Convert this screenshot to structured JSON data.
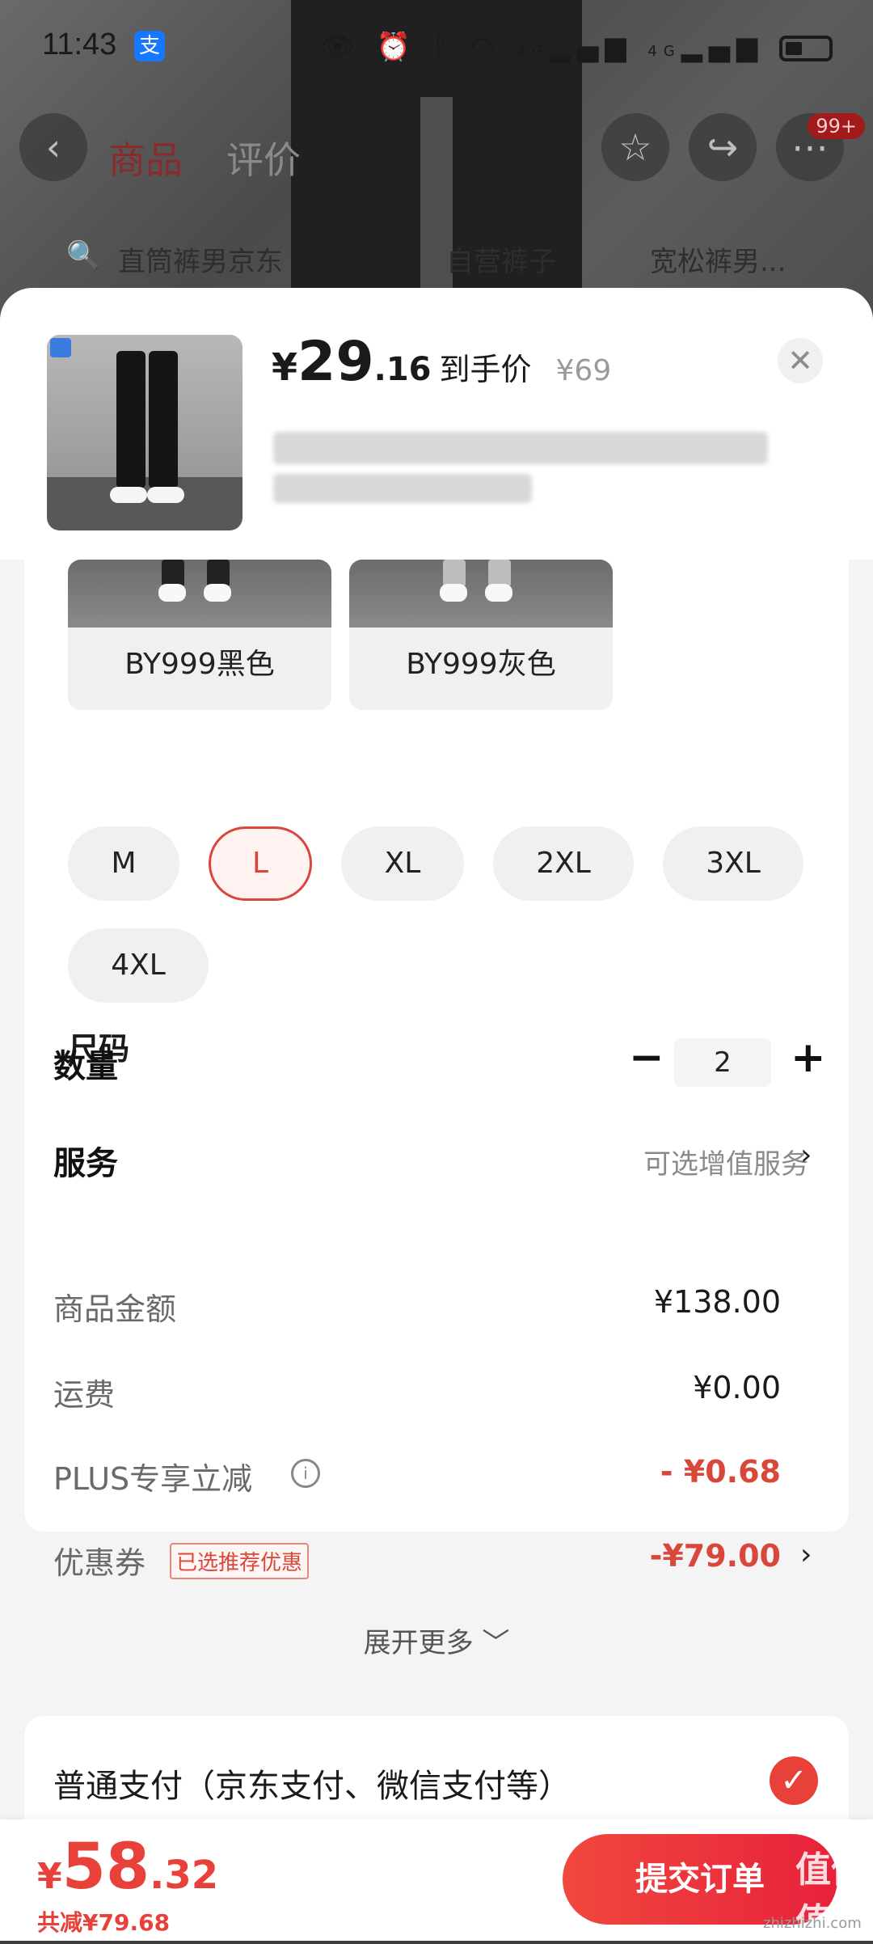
{
  "status_bar": {
    "time": "11:43",
    "alipay_glyph": "支",
    "icons": [
      "eye-icon",
      "alarm-icon",
      "bluetooth-icon",
      "wifi-icon",
      "4g-signal-icon",
      "4g-signal-icon",
      "battery-icon"
    ],
    "net1": "4G",
    "net2": "4G"
  },
  "nav": {
    "tabs": [
      "商品",
      "评价",
      "",
      ""
    ],
    "active_tab": 0,
    "badge": "99+"
  },
  "search": {
    "suggestions": [
      "直筒裤男京东",
      "自营裤子",
      "宽松裤男..."
    ]
  },
  "product": {
    "price_yen": "¥",
    "price_int": "29",
    "price_dec": ".16",
    "price_tag": "到手价",
    "original_price": "¥69"
  },
  "colors": [
    {
      "label": "BY999黑色"
    },
    {
      "label": "BY999灰色"
    }
  ],
  "size": {
    "title": "尺码",
    "options": [
      "M",
      "L",
      "XL",
      "2XL",
      "3XL",
      "4XL"
    ],
    "selected": "L"
  },
  "quantity": {
    "title": "数量",
    "minus": "−",
    "value": "2",
    "plus": "+"
  },
  "service": {
    "title": "服务",
    "hint": "可选增值服务"
  },
  "fees": {
    "goods_label": "商品金额",
    "goods_value": "¥138.00",
    "shipping_label": "运费",
    "shipping_value": "¥0.00",
    "plus_label": "PLUS专享立减",
    "plus_value": "- ¥0.68",
    "coupon_label": "优惠券",
    "coupon_tag": "已选推荐优惠",
    "coupon_value": "-¥79.00",
    "expand": "展开更多"
  },
  "payment": {
    "label": "普通支付（京东支付、微信支付等）"
  },
  "bottom": {
    "total_yen": "¥",
    "total_int": "58",
    "total_dec": ".32",
    "saved": "共减¥79.68",
    "submit": "提交订单",
    "watermark": "值值值",
    "watermark_url": "zhizhizhi.com"
  },
  "colors_theme": {
    "accent_red": "#e8413a",
    "selected_border": "#d9463a"
  }
}
